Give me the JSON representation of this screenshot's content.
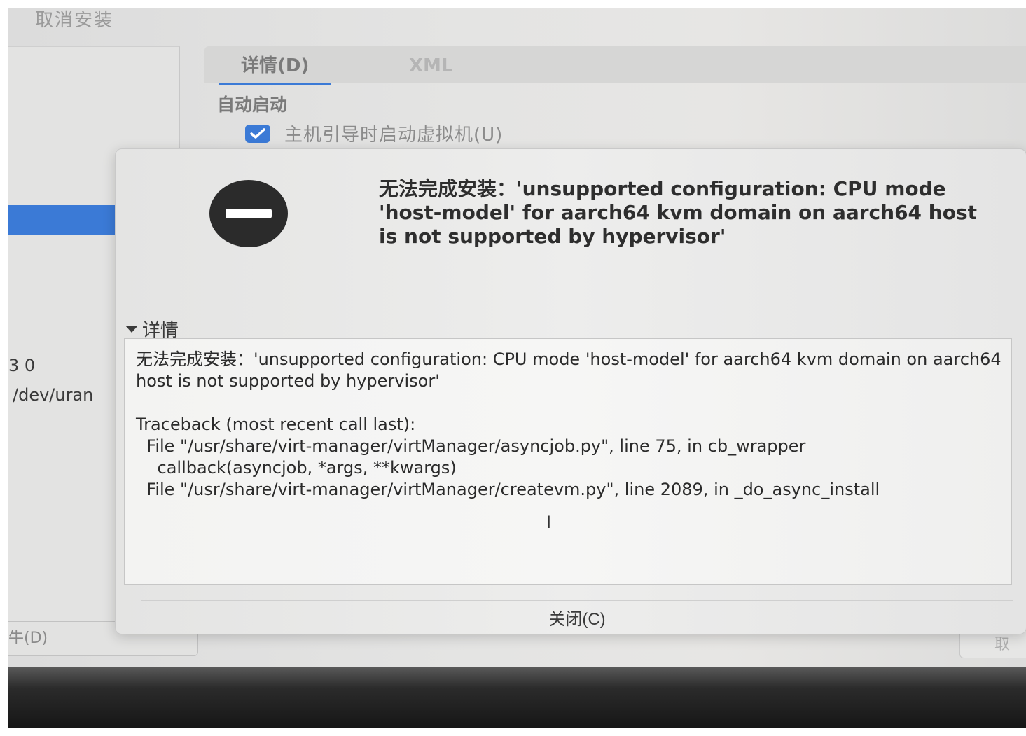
{
  "window": {
    "title": "取消安装"
  },
  "tabs": [
    {
      "label": "详情(D)"
    },
    {
      "label": "XML"
    }
  ],
  "autostart": {
    "heading": "自动启动",
    "checkbox_label": "主机引导时启动虚拟机(U)",
    "checked": true
  },
  "left_pane": {
    "fragment_1": "3 0",
    "fragment_2": "/dev/uran",
    "fragment_3": "牛(D)"
  },
  "bottom": {
    "right_button_label": "取"
  },
  "dialog": {
    "icon": "error-icon",
    "message": "无法完成安装：'unsupported configuration: CPU mode 'host-model' for aarch64 kvm domain on aarch64 host is not supported by hypervisor'",
    "details_label": "详情",
    "details_text": "无法完成安装：'unsupported configuration: CPU mode 'host-model' for aarch64 kvm domain on aarch64 host is not supported by hypervisor'\n\nTraceback (most recent call last):\n  File \"/usr/share/virt-manager/virtManager/asyncjob.py\", line 75, in cb_wrapper\n    callback(asyncjob, *args, **kwargs)\n  File \"/usr/share/virt-manager/virtManager/createvm.py\", line 2089, in _do_async_install",
    "close_label": "关闭(C)"
  },
  "colors": {
    "accent": "#3b7ad6",
    "icon": "#2b2b2b"
  }
}
